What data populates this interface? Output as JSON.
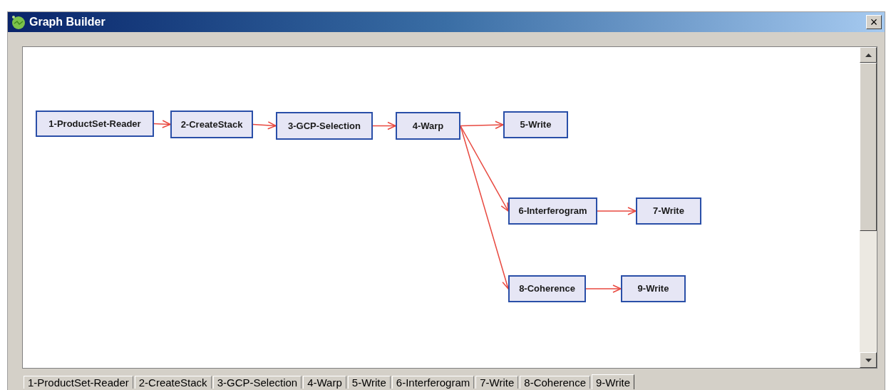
{
  "window": {
    "title": "Graph Builder",
    "close": "×"
  },
  "graph": {
    "nodes": [
      {
        "label": "1-ProductSet-Reader"
      },
      {
        "label": "2-CreateStack"
      },
      {
        "label": "3-GCP-Selection"
      },
      {
        "label": "4-Warp"
      },
      {
        "label": "5-Write"
      },
      {
        "label": "6-Interferogram"
      },
      {
        "label": "7-Write"
      },
      {
        "label": "8-Coherence"
      },
      {
        "label": "9-Write"
      }
    ]
  },
  "tabs": [
    {
      "label": "1-ProductSet-Reader",
      "selected": false
    },
    {
      "label": "2-CreateStack",
      "selected": false
    },
    {
      "label": "3-GCP-Selection",
      "selected": false
    },
    {
      "label": "4-Warp",
      "selected": false
    },
    {
      "label": "5-Write",
      "selected": false
    },
    {
      "label": "6-Interferogram",
      "selected": false
    },
    {
      "label": "7-Write",
      "selected": false
    },
    {
      "label": "8-Coherence",
      "selected": false
    },
    {
      "label": "9-Write",
      "selected": true
    }
  ]
}
